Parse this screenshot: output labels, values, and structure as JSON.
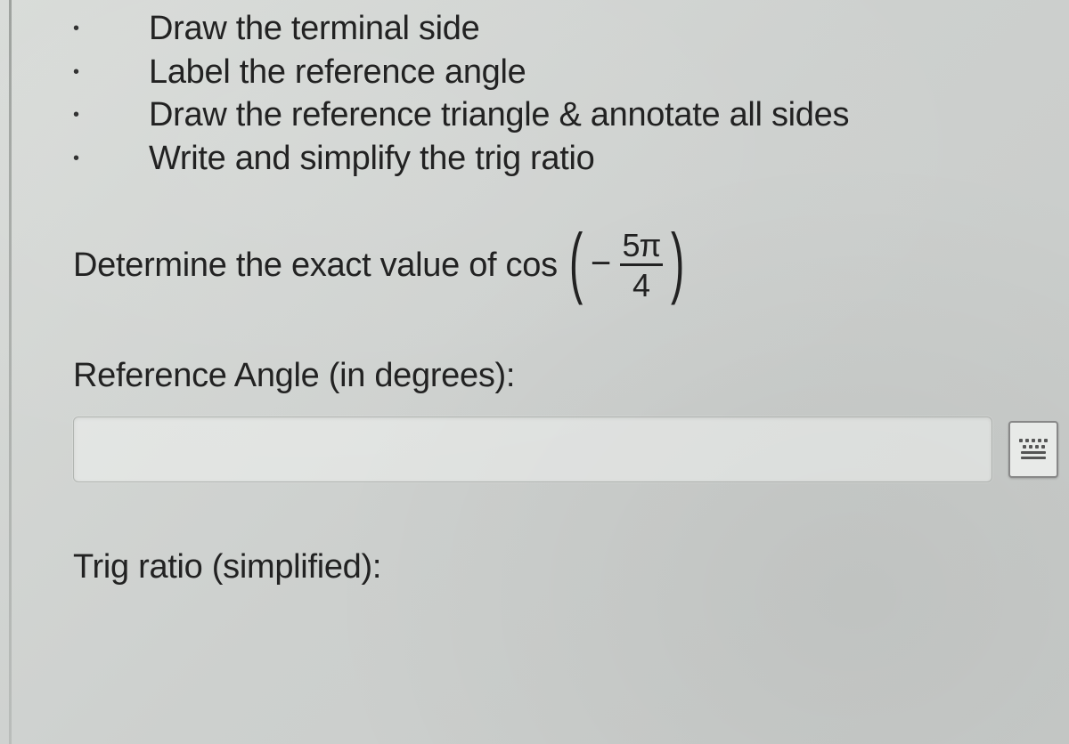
{
  "bullets": [
    "Draw the terminal side",
    "Label the reference angle",
    "Draw the reference triangle & annotate all sides",
    "Write and simplify the trig ratio"
  ],
  "question": {
    "prefix": "Determine the exact value of cos",
    "paren_left": "(",
    "minus": "−",
    "fraction_num": "5π",
    "fraction_den": "4",
    "paren_right": ")"
  },
  "fields": {
    "reference_angle_label": "Reference Angle (in degrees):",
    "reference_angle_value": "",
    "trig_ratio_label": "Trig ratio (simplified):"
  }
}
